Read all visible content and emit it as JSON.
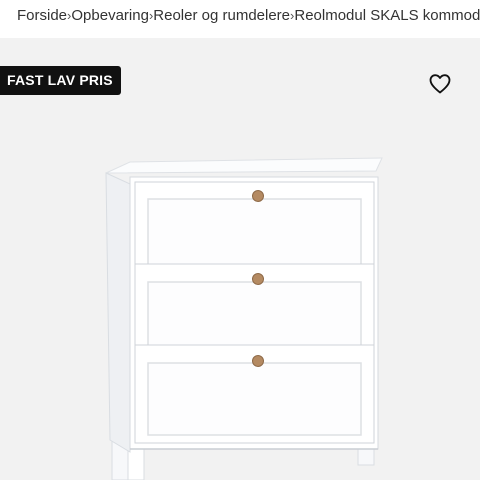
{
  "breadcrumb": {
    "items": [
      {
        "label": "Forside"
      },
      {
        "label": "Opbevaring"
      },
      {
        "label": "Reoler og rumdelere"
      },
      {
        "label": "Reolmodul SKALS kommode"
      }
    ],
    "separator": "›"
  },
  "product": {
    "badge": "FAST LAV PRIS",
    "favorite_icon": "heart-outline-icon",
    "image_alt": "white 3-drawer chest with wooden knobs"
  },
  "colors": {
    "badge_bg": "#111111",
    "badge_text": "#ffffff",
    "image_bg": "#f2f2f2"
  }
}
